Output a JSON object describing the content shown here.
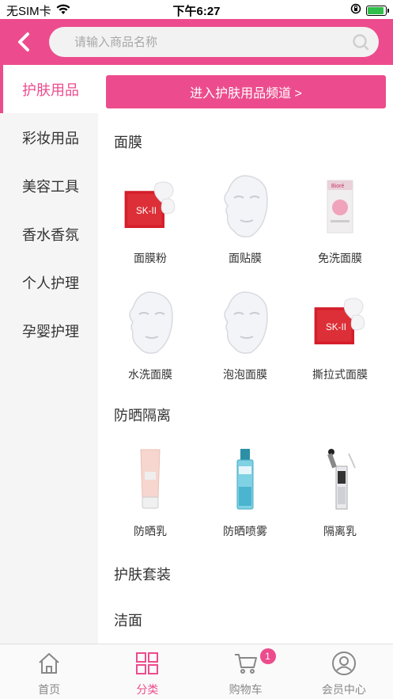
{
  "status_bar": {
    "carrier": "无SIM卡",
    "time": "下午6:27"
  },
  "search": {
    "placeholder": "请输入商品名称"
  },
  "sidebar": {
    "items": [
      {
        "label": "护肤用品",
        "active": true
      },
      {
        "label": "彩妆用品",
        "active": false
      },
      {
        "label": "美容工具",
        "active": false
      },
      {
        "label": "香水香氛",
        "active": false
      },
      {
        "label": "个人护理",
        "active": false
      },
      {
        "label": "孕婴护理",
        "active": false
      }
    ]
  },
  "content": {
    "channel_button": "进入护肤用品频道 >",
    "sections": [
      {
        "title": "面膜",
        "items": [
          {
            "label": "面膜粉",
            "icon": "red-mask-box-icon"
          },
          {
            "label": "面贴膜",
            "icon": "sheet-mask-icon"
          },
          {
            "label": "免洗面膜",
            "icon": "mask-packet-icon"
          },
          {
            "label": "水洗面膜",
            "icon": "sheet-mask-icon"
          },
          {
            "label": "泡泡面膜",
            "icon": "sheet-mask-icon"
          },
          {
            "label": "撕拉式面膜",
            "icon": "red-mask-box-icon"
          }
        ]
      },
      {
        "title": "防晒隔离",
        "items": [
          {
            "label": "防晒乳",
            "icon": "sunscreen-tube-icon"
          },
          {
            "label": "防晒喷雾",
            "icon": "spray-bottle-icon"
          },
          {
            "label": "隔离乳",
            "icon": "dropper-bottle-icon"
          }
        ]
      },
      {
        "title": "护肤套装",
        "items": []
      },
      {
        "title": "洁面",
        "items": []
      }
    ]
  },
  "tabbar": {
    "tabs": [
      {
        "label": "首页",
        "icon": "home-icon",
        "active": false
      },
      {
        "label": "分类",
        "icon": "grid-icon",
        "active": true
      },
      {
        "label": "购物车",
        "icon": "cart-icon",
        "active": false
      },
      {
        "label": "会员中心",
        "icon": "user-icon",
        "active": false
      }
    ],
    "cart_badge": "1"
  },
  "colors": {
    "accent": "#ec4c8d",
    "sidebar_bg": "#f5f5f5"
  }
}
